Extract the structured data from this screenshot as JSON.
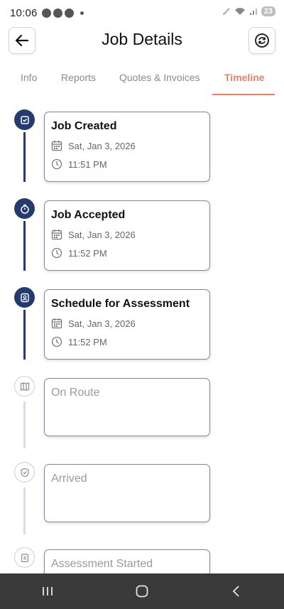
{
  "status_bar": {
    "time": "10:06",
    "battery": "23"
  },
  "header": {
    "title": "Job Details",
    "back_icon": "arrow-left-icon",
    "refresh_icon": "refresh-icon"
  },
  "tabs": [
    {
      "label": "Info",
      "active": false
    },
    {
      "label": "Reports",
      "active": false
    },
    {
      "label": "Quotes & Invoices",
      "active": false
    },
    {
      "label": "Timeline",
      "active": true
    }
  ],
  "timeline": [
    {
      "title": "Job Created",
      "date": "Sat, Jan 3, 2026",
      "time": "11:51 PM",
      "status": "done",
      "icon": "calendar-check-icon"
    },
    {
      "title": "Job Accepted",
      "date": "Sat, Jan 3, 2026",
      "time": "11:52 PM",
      "status": "done",
      "icon": "timer-icon"
    },
    {
      "title": "Schedule for Assessment",
      "date": "Sat, Jan 3, 2026",
      "time": "11:52 PM",
      "status": "done",
      "icon": "person-badge-icon"
    },
    {
      "title": "On Route",
      "status": "pending",
      "icon": "map-icon"
    },
    {
      "title": "Arrived",
      "status": "pending",
      "icon": "shield-check-icon"
    },
    {
      "title": "Assessment Started",
      "status": "pending",
      "icon": "clipboard-icon"
    }
  ],
  "colors": {
    "accent": "#e0826a",
    "done": "#243b6e",
    "pending_line": "#dcdcdc"
  }
}
